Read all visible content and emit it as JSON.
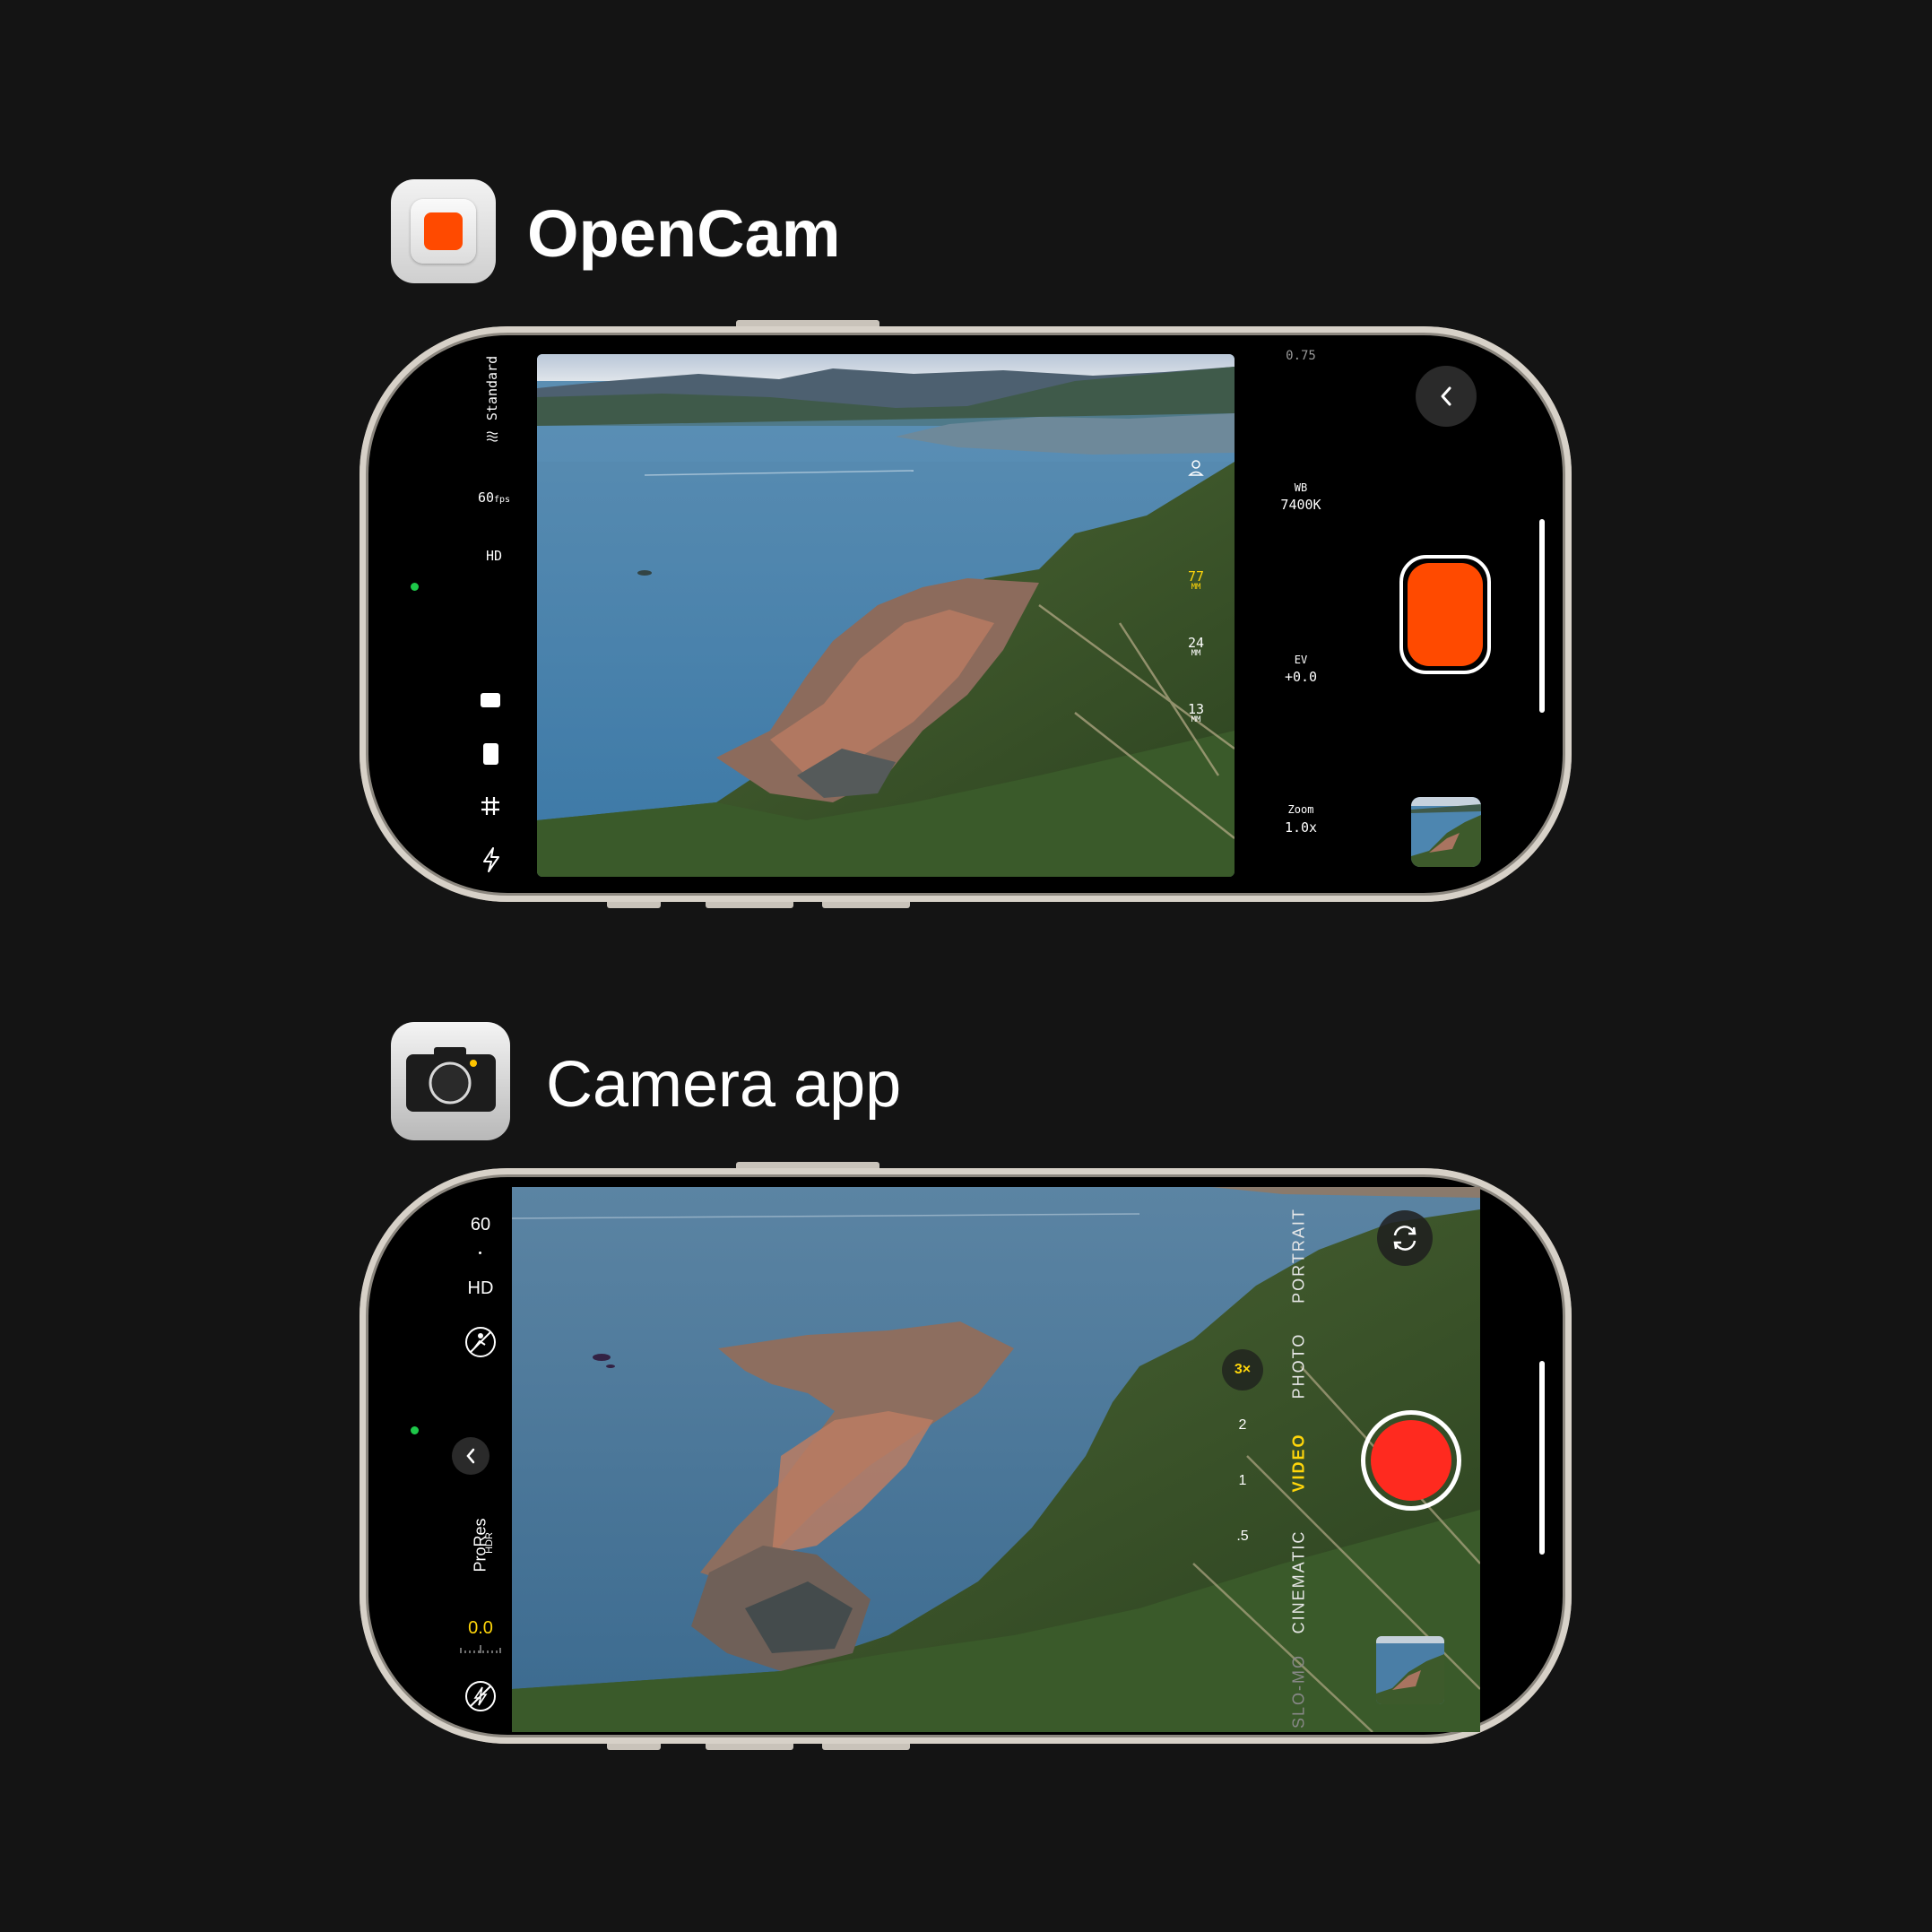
{
  "opencam": {
    "app_title": "OpenCam",
    "preset": "Standard",
    "fps_value": "60",
    "fps_unit": "fps",
    "resolution": "HD",
    "top_value": "0.75",
    "wb_label": "WB",
    "wb_value": "7400K",
    "ev_label": "EV",
    "ev_value": "+0.0",
    "zoom_label": "Zoom",
    "zoom_value": "1.0x",
    "lenses": [
      {
        "value": "77",
        "unit": "MM",
        "active": true
      },
      {
        "value": "24",
        "unit": "MM",
        "active": false
      },
      {
        "value": "13",
        "unit": "MM",
        "active": false
      }
    ],
    "record_color": "#ff4a00",
    "accent": "#ffd60a"
  },
  "camera": {
    "app_title": "Camera app",
    "fps": "60",
    "resolution": "HD",
    "format_main": "ProRes",
    "format_sub": "HDR",
    "exposure": "0.0",
    "modes": [
      "PORTRAIT",
      "PHOTO",
      "VIDEO",
      "CINEMATIC",
      "SLO-MO"
    ],
    "active_mode": "VIDEO",
    "zoom_levels": [
      "3×",
      ".5",
      "1",
      "2"
    ],
    "zoom_3x": "3×",
    "zoom_2": "2",
    "zoom_1": "1",
    "zoom_05": ".5",
    "record_color": "#ff2a1f",
    "accent": "#ffd60a"
  }
}
